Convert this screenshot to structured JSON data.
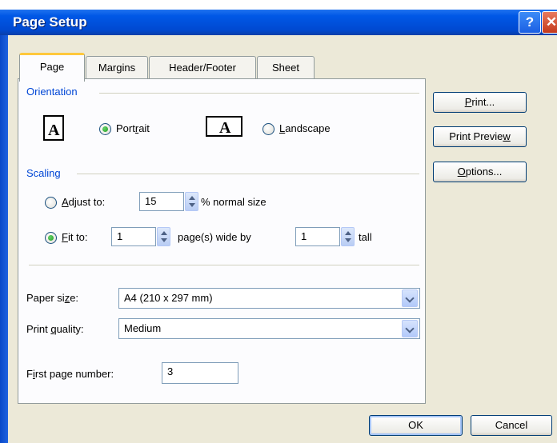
{
  "window": {
    "title": "Page Setup",
    "help_glyph": "?",
    "close_glyph": "✕"
  },
  "tabs": [
    {
      "label": "Page"
    },
    {
      "label": "Margins"
    },
    {
      "label": "Header/Footer"
    },
    {
      "label": "Sheet"
    }
  ],
  "orientation": {
    "group_label": "Orientation",
    "portrait_prefix": "Port",
    "portrait_u": "r",
    "portrait_suffix": "ait",
    "landscape_u": "L",
    "landscape_suffix": "andscape",
    "icon_glyph": "A",
    "selected": "Portrait"
  },
  "scaling": {
    "group_label": "Scaling",
    "adjust_u": "A",
    "adjust_suffix": "djust to:",
    "adjust_value": "15",
    "adjust_suffix_label": "% normal size",
    "fit_u": "F",
    "fit_suffix": "it to:",
    "fit_wide_value": "1",
    "fit_wide_label": "page(s) wide by",
    "fit_tall_value": "1",
    "fit_tall_label": "tall",
    "selected": "Fit to"
  },
  "paper": {
    "size_prefix": "Paper si",
    "size_u": "z",
    "size_suffix": "e:",
    "size_value": "A4 (210 x 297 mm)",
    "quality_prefix": "Print ",
    "quality_u": "q",
    "quality_suffix": "uality:",
    "quality_value": "Medium",
    "first_prefix": "F",
    "first_u": "i",
    "first_suffix": "rst page number:",
    "first_value": "3"
  },
  "side_buttons": {
    "print_u": "P",
    "print_suffix": "rint...",
    "preview_prefix": "Print Previe",
    "preview_u": "w",
    "options_u": "O",
    "options_suffix": "ptions..."
  },
  "footer": {
    "ok": "OK",
    "cancel": "Cancel"
  }
}
